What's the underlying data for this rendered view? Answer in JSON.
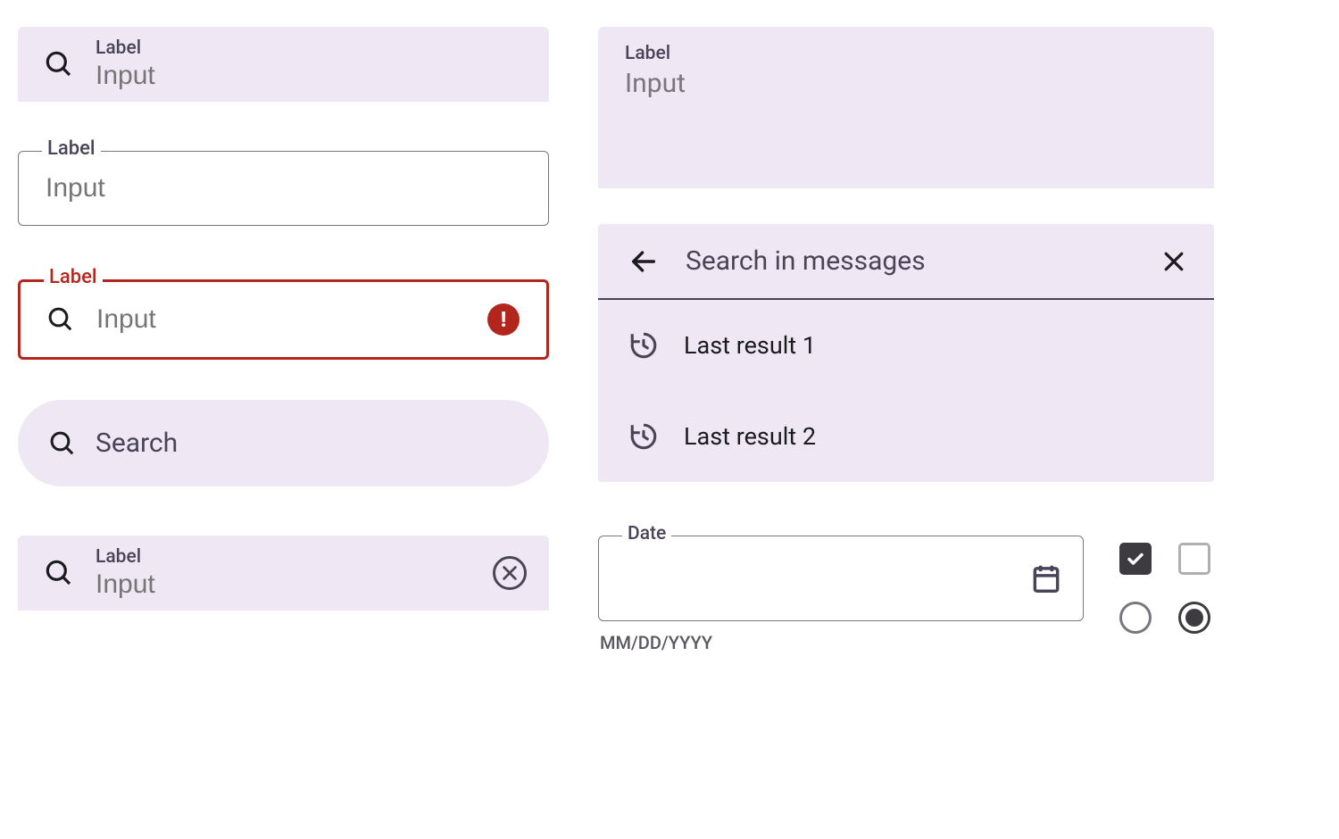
{
  "left": {
    "field1": {
      "label": "Label",
      "placeholder": "Input"
    },
    "field2": {
      "label": "Label",
      "placeholder": "Input"
    },
    "field3": {
      "label": "Label",
      "placeholder": "Input"
    },
    "search_pill": {
      "placeholder": "Search"
    },
    "field5": {
      "label": "Label",
      "placeholder": "Input"
    }
  },
  "right": {
    "multiline": {
      "label": "Label",
      "placeholder": "Input"
    },
    "search_panel": {
      "placeholder": "Search in messages",
      "results": [
        {
          "label": "Last result 1"
        },
        {
          "label": "Last result 2"
        }
      ]
    },
    "date_field": {
      "label": "Date",
      "helper": "MM/DD/YYYY"
    },
    "controls": {
      "checkbox_checked": true,
      "checkbox_unchecked": false,
      "radio_unselected": false,
      "radio_selected": true
    }
  },
  "colors": {
    "surface": "#efe8f4",
    "error": "#b3261e",
    "outline": "#79747e"
  }
}
